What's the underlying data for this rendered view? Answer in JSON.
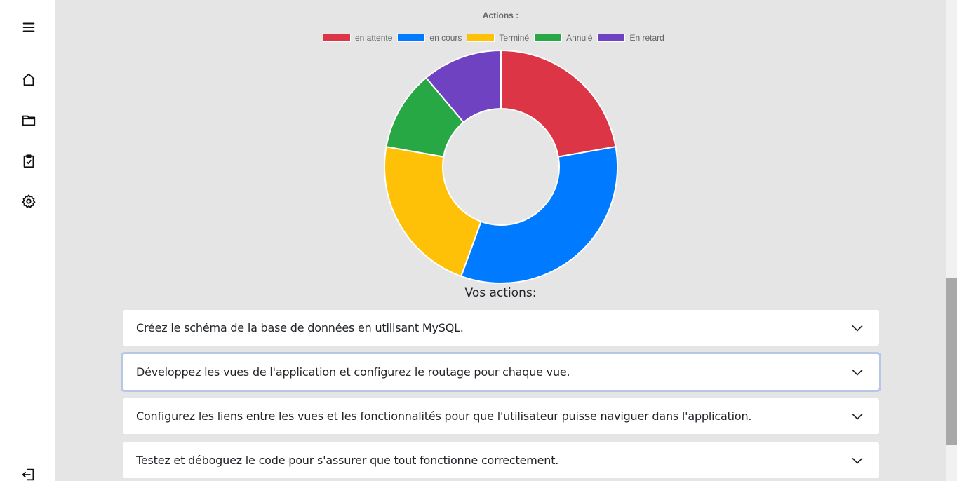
{
  "sidebar": {
    "items": [
      {
        "name": "menu",
        "icon": "hamburger-icon"
      },
      {
        "name": "home",
        "icon": "home-icon"
      },
      {
        "name": "projects",
        "icon": "folder-icon"
      },
      {
        "name": "tasks",
        "icon": "clipboard-check-icon"
      },
      {
        "name": "settings",
        "icon": "gear-icon"
      },
      {
        "name": "logout",
        "icon": "logout-icon"
      }
    ]
  },
  "chart_data": {
    "type": "pie",
    "title": "Actions :",
    "legend_position": "top",
    "categories": [
      "en attente",
      "en cours",
      "Terminé",
      "Annulé",
      "En retard"
    ],
    "values": [
      2,
      3,
      2,
      1,
      1
    ],
    "colors": [
      "#dc3545",
      "#007bff",
      "#ffc107",
      "#28a745",
      "#6f42c1"
    ]
  },
  "main": {
    "section_title": "Vos actions:",
    "actions": [
      {
        "label": "Créez le schéma de la base de données en utilisant MySQL."
      },
      {
        "label": "Développez les vues de l'application et configurez le routage pour chaque vue."
      },
      {
        "label": "Configurez les liens entre les vues et les fonctionnalités pour que l'utilisateur puisse naviguer dans l'application."
      },
      {
        "label": "Testez et déboguez le code pour s'assurer que tout fonctionne correctement."
      }
    ]
  }
}
